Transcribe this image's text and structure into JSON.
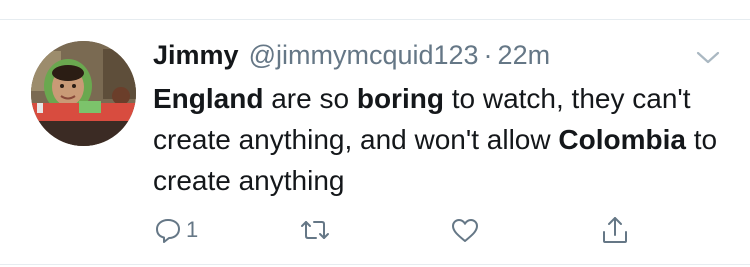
{
  "tweet": {
    "display_name": "Jimmy",
    "handle": "@jimmymcquid123",
    "separator": "·",
    "timestamp": "22m",
    "text_segments": [
      {
        "text": "England",
        "bold": true
      },
      {
        "text": " are so ",
        "bold": false
      },
      {
        "text": "boring",
        "bold": true
      },
      {
        "text": " to watch, they can't create anything, and won't allow ",
        "bold": false
      },
      {
        "text": "Colombia",
        "bold": true
      },
      {
        "text": " to create anything",
        "bold": false
      }
    ]
  },
  "actions": {
    "reply_icon": "reply-icon",
    "reply_count": "1",
    "retweet_icon": "retweet-icon",
    "like_icon": "heart-icon",
    "share_icon": "share-icon"
  },
  "colors": {
    "text": "#14171a",
    "secondary": "#657786",
    "icon": "#657786",
    "divider": "#e6ecf0"
  }
}
